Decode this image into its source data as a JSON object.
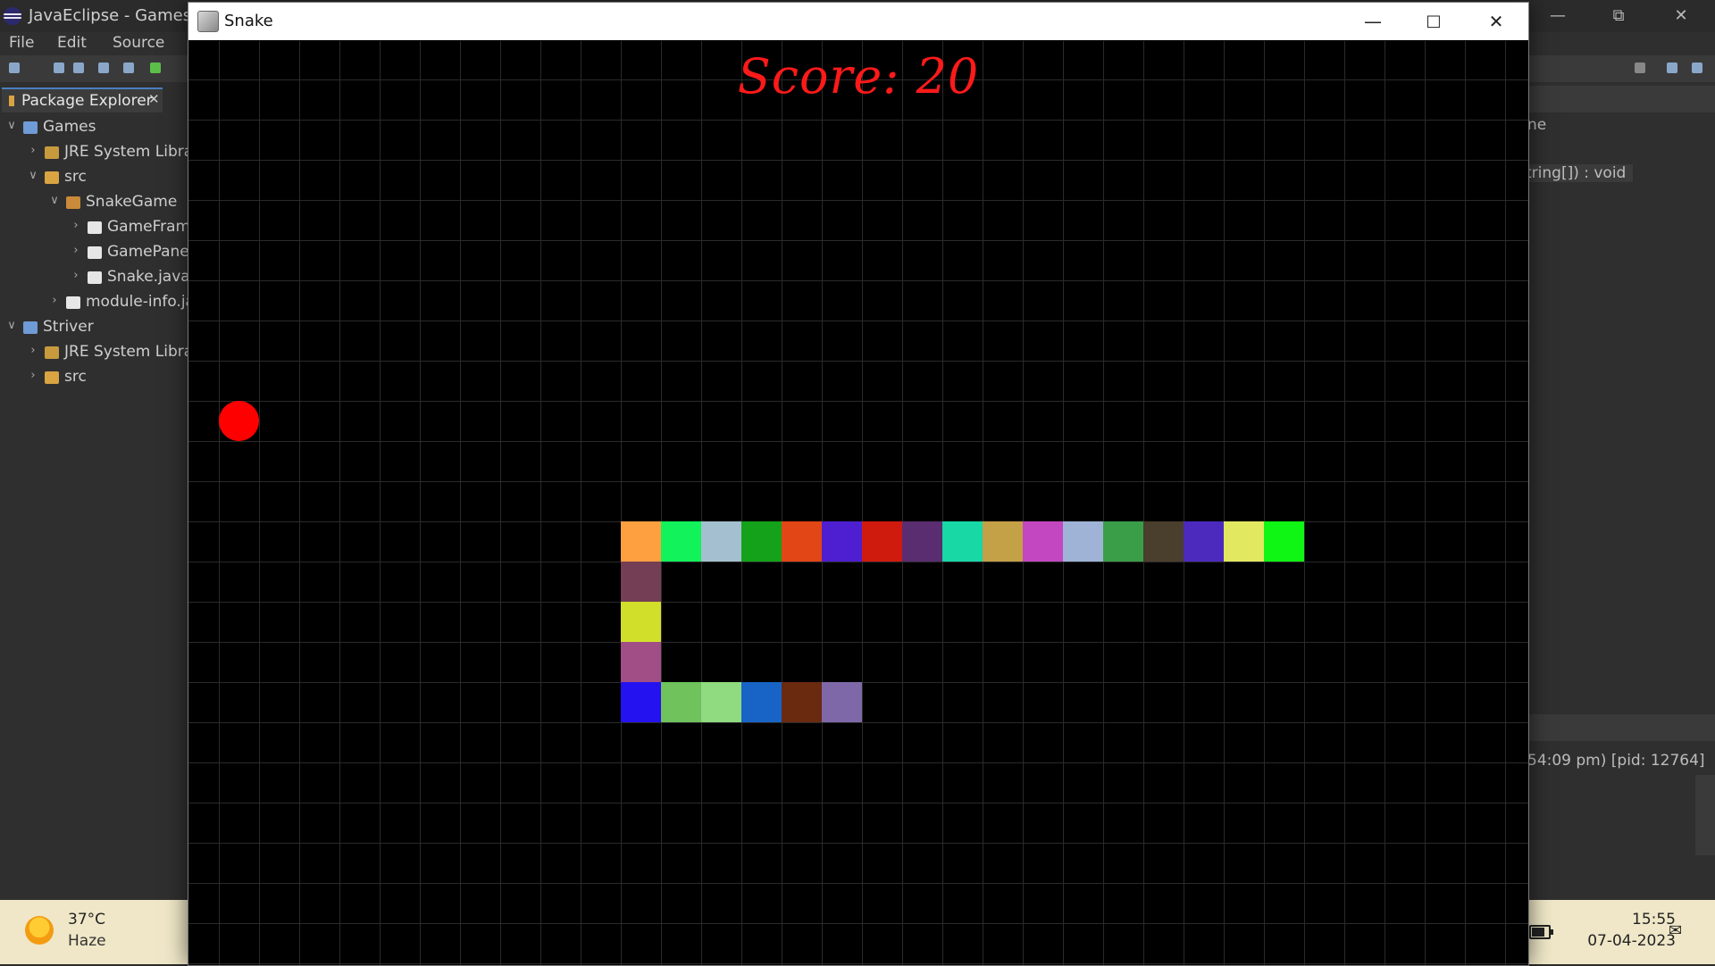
{
  "eclipse": {
    "title": "JavaEclipse - Games/s",
    "menu": [
      "File",
      "Edit",
      "Source"
    ],
    "package_explorer": {
      "tab_label": "Package Explorer",
      "tree": [
        {
          "label": "Games",
          "depth": 0,
          "expanded": true,
          "icon": "project-icon"
        },
        {
          "label": "JRE System Librar",
          "depth": 1,
          "expanded": false,
          "icon": "library-icon"
        },
        {
          "label": "src",
          "depth": 1,
          "expanded": true,
          "icon": "source-folder-icon"
        },
        {
          "label": "SnakeGame",
          "depth": 2,
          "expanded": true,
          "icon": "package-icon"
        },
        {
          "label": "GameFram",
          "depth": 3,
          "expanded": false,
          "icon": "java-file-icon"
        },
        {
          "label": "GamePanel",
          "depth": 3,
          "expanded": false,
          "icon": "java-file-icon"
        },
        {
          "label": "Snake.java",
          "depth": 3,
          "expanded": false,
          "icon": "java-file-icon"
        },
        {
          "label": "module-info.ja",
          "depth": 2,
          "expanded": false,
          "icon": "java-file-icon"
        },
        {
          "label": "Striver",
          "depth": 0,
          "expanded": true,
          "icon": "project-icon"
        },
        {
          "label": "JRE System Librar",
          "depth": 1,
          "expanded": false,
          "icon": "library-icon"
        },
        {
          "label": "src",
          "depth": 1,
          "expanded": false,
          "icon": "source-folder-icon"
        }
      ]
    },
    "outline": {
      "fragment_1": "ne",
      "fragment_2": "tring[]) : void"
    },
    "console": {
      "fragment": "54:09 pm) [pid: 12764]"
    }
  },
  "snake_window": {
    "title": "Snake",
    "score_text": "Score: 20",
    "grid_cols": 33,
    "grid_rows": 23,
    "apple": {
      "col": 1,
      "row": 9,
      "color": "#ff0000"
    },
    "snake": [
      {
        "col": 11,
        "row": 12,
        "color": "#ffa040"
      },
      {
        "col": 12,
        "row": 12,
        "color": "#12f25a"
      },
      {
        "col": 13,
        "row": 12,
        "color": "#a4bfcf"
      },
      {
        "col": 14,
        "row": 12,
        "color": "#13a21a"
      },
      {
        "col": 15,
        "row": 12,
        "color": "#e24516"
      },
      {
        "col": 16,
        "row": 12,
        "color": "#4e1fd0"
      },
      {
        "col": 17,
        "row": 12,
        "color": "#cf1a0e"
      },
      {
        "col": 18,
        "row": 12,
        "color": "#5a2d70"
      },
      {
        "col": 19,
        "row": 12,
        "color": "#18d8a6"
      },
      {
        "col": 20,
        "row": 12,
        "color": "#c4a046"
      },
      {
        "col": 21,
        "row": 12,
        "color": "#c347c0"
      },
      {
        "col": 22,
        "row": 12,
        "color": "#9fb3d6"
      },
      {
        "col": 23,
        "row": 12,
        "color": "#3a9e48"
      },
      {
        "col": 24,
        "row": 12,
        "color": "#4a3e2c"
      },
      {
        "col": 25,
        "row": 12,
        "color": "#4c2abe"
      },
      {
        "col": 26,
        "row": 12,
        "color": "#e2e860"
      },
      {
        "col": 27,
        "row": 12,
        "color": "#0ff514"
      },
      {
        "col": 11,
        "row": 13,
        "color": "#743e54"
      },
      {
        "col": 11,
        "row": 14,
        "color": "#d2df2a"
      },
      {
        "col": 11,
        "row": 15,
        "color": "#a24e86"
      },
      {
        "col": 11,
        "row": 16,
        "color": "#2512f0"
      },
      {
        "col": 12,
        "row": 16,
        "color": "#6fc25c"
      },
      {
        "col": 13,
        "row": 16,
        "color": "#90da80"
      },
      {
        "col": 14,
        "row": 16,
        "color": "#1864c6"
      },
      {
        "col": 15,
        "row": 16,
        "color": "#6a2a10"
      },
      {
        "col": 16,
        "row": 16,
        "color": "#7e68a8"
      }
    ],
    "colors": {
      "background": "#000000",
      "grid_line": "#2a2a2a",
      "score": "#ff1a1a"
    }
  },
  "taskbar": {
    "temperature": "37°C",
    "weather": "Haze",
    "time": "15:55",
    "date": "07-04-2023"
  }
}
